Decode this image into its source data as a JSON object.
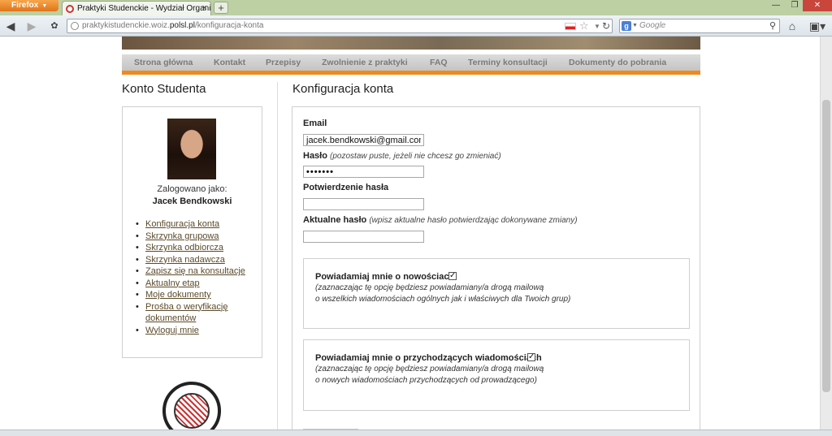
{
  "browser": {
    "app_button": "Firefox",
    "tab_title": "Praktyki Studenckie - Wydział Organizacji...",
    "url_prefix": "praktykistudenckie.woiz.",
    "url_host": "polsl.pl",
    "url_path": "/konfiguracja-konta",
    "search_placeholder": "Google"
  },
  "menu": [
    "Strona główna",
    "Kontakt",
    "Przepisy",
    "Zwolnienie z praktyki",
    "FAQ",
    "Terminy konsultacji",
    "Dokumenty do pobrania"
  ],
  "sidebar": {
    "title": "Konto Studenta",
    "logged_as": "Zalogowano jako:",
    "user_name": "Jacek Bendkowski",
    "items": [
      "Konfiguracja konta",
      "Skrzynka grupowa",
      "Skrzynka odbiorcza",
      "Skrzynka nadawcza",
      "Zapisz się na konsultacje",
      "Aktualny etap",
      "Moje dokumenty",
      "Prośba o weryfikację dokumentów",
      "Wyloguj mnie"
    ]
  },
  "form": {
    "title": "Konfiguracja konta",
    "email_label": "Email",
    "email_value": "jacek.bendkowski@gmail.com",
    "password_label": "Hasło",
    "password_hint": "(pozostaw puste, jeżeli nie chcesz go zmieniać)",
    "password_value": "•••••••",
    "confirm_label": "Potwierdzenie hasła",
    "current_label": "Aktualne hasło",
    "current_hint": "(wpisz aktualne hasło potwierdzając dokonywane zmiany)",
    "notify_news": {
      "label": "Powiadamiaj mnie o nowościach",
      "checked": true,
      "desc1": "(zaznaczając tę opcję będziesz powiadamiany/a drogą mailową",
      "desc2": "o wszelkich wiadomościach ogólnych jak i właściwych dla Twoich grup)"
    },
    "notify_messages": {
      "label": "Powiadamiaj mnie o przychodzących wiadomościach",
      "checked": true,
      "desc1": "(zaznaczając tę opcję będziesz powiadamiany/a drogą mailową",
      "desc2": "o nowych wiadomościach przychodzących od prowadzącego)"
    }
  }
}
